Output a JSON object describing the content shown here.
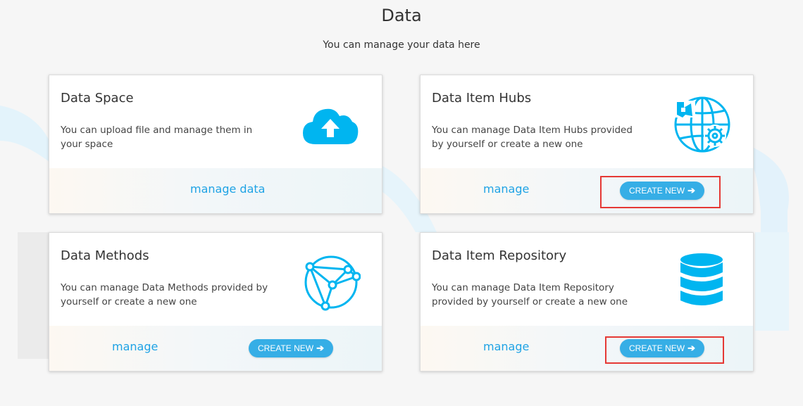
{
  "page": {
    "title": "Data",
    "subtitle": "You can manage your data here"
  },
  "cards": [
    {
      "title": "Data Space",
      "description": "You can upload file and manage them in your space",
      "manage_label": "manage data",
      "icon": "cloud-upload-icon"
    },
    {
      "title": "Data Item Hubs",
      "description": "You can manage Data Item Hubs provided by yourself or create a new one",
      "manage_label": "manage",
      "create_label": "CREATE NEW",
      "create_arrow": "➔",
      "icon": "globe-gear-icon"
    },
    {
      "title": "Data Methods",
      "description": "You can manage Data Methods provided by yourself or create a new one",
      "manage_label": "manage",
      "create_label": "CREATE NEW",
      "create_arrow": "➔",
      "icon": "network-icon"
    },
    {
      "title": "Data Item Repository",
      "description": "You can manage Data Item Repository provided by yourself or create a new one",
      "manage_label": "manage",
      "create_label": "CREATE NEW",
      "create_arrow": "➔",
      "icon": "database-icon"
    }
  ],
  "colors": {
    "accent": "#1fa3e5",
    "button": "#36aee6",
    "highlight": "#e53935"
  }
}
